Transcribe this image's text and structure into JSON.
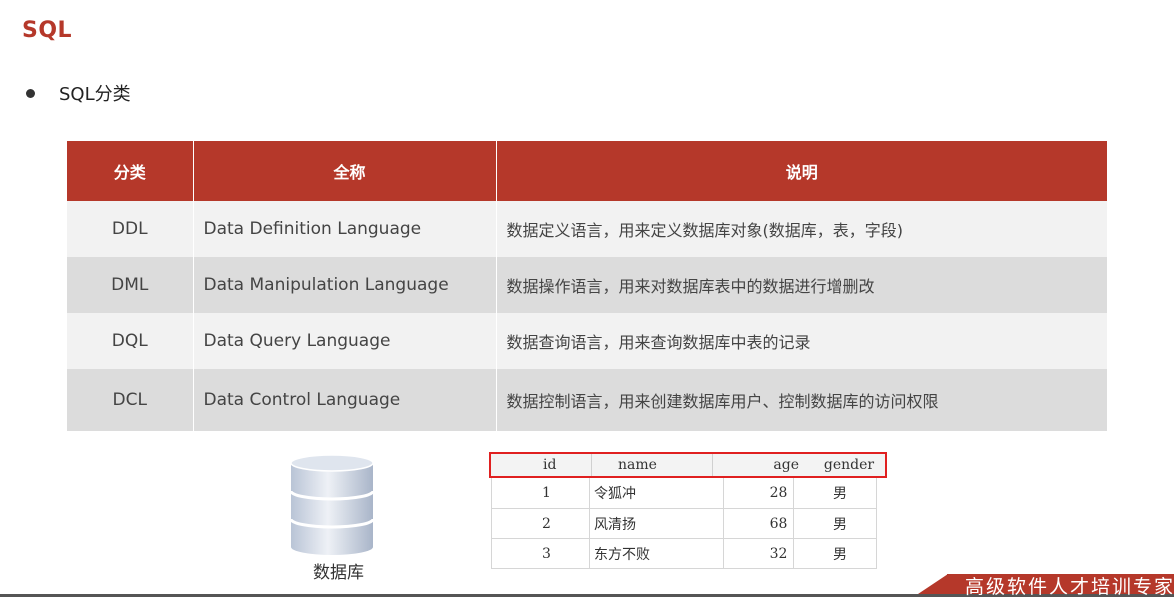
{
  "title": "SQL",
  "bullet": "SQL分类",
  "table": {
    "headers": [
      "分类",
      "全称",
      "说明"
    ],
    "rows": [
      {
        "code": "DDL",
        "name": "Data Definition Language",
        "desc": "数据定义语言，用来定义数据库对象(数据库，表，字段)"
      },
      {
        "code": "DML",
        "name": "Data Manipulation Language",
        "desc": "数据操作语言，用来对数据库表中的数据进行增删改"
      },
      {
        "code": "DQL",
        "name": "Data Query Language",
        "desc": "数据查询语言，用来查询数据库中表的记录"
      },
      {
        "code": "DCL",
        "name": "Data Control Language",
        "desc": "数据控制语言，用来创建数据库用户、控制数据库的访问权限"
      }
    ]
  },
  "database_label": "数据库",
  "sample": {
    "headers": [
      "id",
      "name",
      "age",
      "gender"
    ],
    "rows": [
      {
        "id": "1",
        "name": "令狐冲",
        "age": "28",
        "gender": "男"
      },
      {
        "id": "2",
        "name": "风清扬",
        "age": "68",
        "gender": "男"
      },
      {
        "id": "3",
        "name": "东方不败",
        "age": "32",
        "gender": "男"
      }
    ]
  },
  "brand": "高级软件人才培训专家",
  "colors": {
    "accent": "#b5382a",
    "highlight_border": "#e02020"
  }
}
